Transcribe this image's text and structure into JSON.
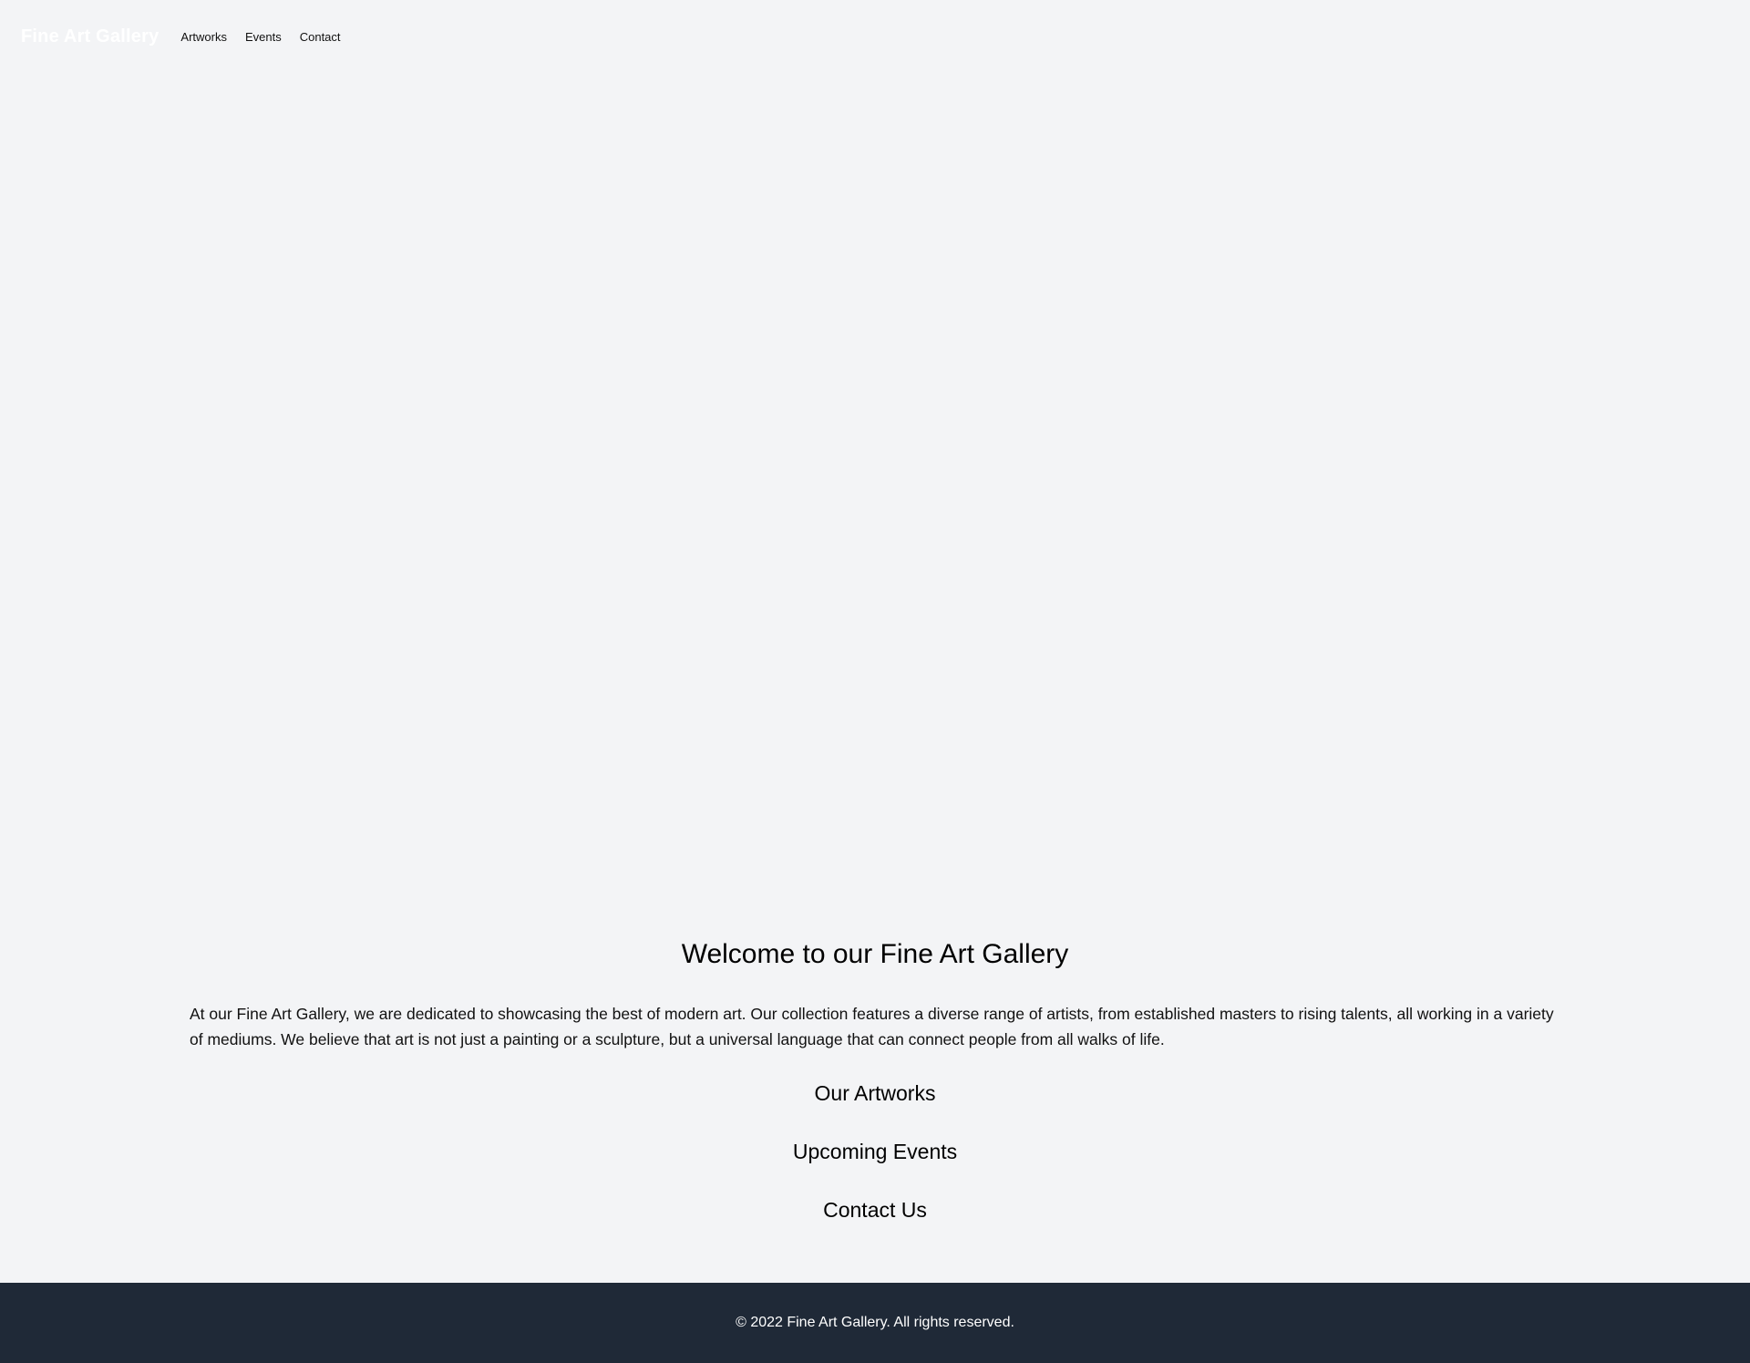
{
  "header": {
    "brand": "Fine Art Gallery",
    "nav": [
      {
        "label": "Artworks"
      },
      {
        "label": "Events"
      },
      {
        "label": "Contact"
      }
    ]
  },
  "main": {
    "title": "Welcome to our Fine Art Gallery",
    "intro": "At our Fine Art Gallery, we are dedicated to showcasing the best of modern art. Our collection features a diverse range of artists, from established masters to rising talents, all working in a variety of mediums. We believe that art is not just a painting or a sculpture, but a universal language that can connect people from all walks of life.",
    "sections": [
      {
        "heading": "Our Artworks"
      },
      {
        "heading": "Upcoming Events"
      },
      {
        "heading": "Contact Us"
      }
    ]
  },
  "footer": {
    "copyright": "© 2022 Fine Art Gallery. All rights reserved."
  },
  "colors": {
    "background": "#f3f4f6",
    "footer_background": "#1f2937",
    "brand_text": "#ffffff"
  }
}
